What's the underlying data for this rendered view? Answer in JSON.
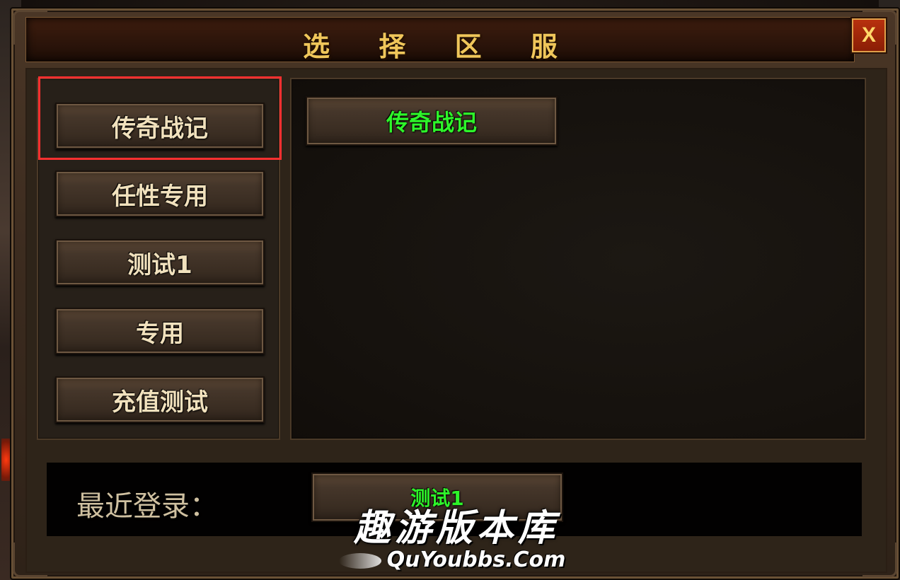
{
  "window": {
    "title": "选 择 区 服",
    "close_label": "X"
  },
  "server_groups": [
    {
      "label": "传奇战记",
      "selected": true
    },
    {
      "label": "任性专用",
      "selected": false
    },
    {
      "label": "测试1",
      "selected": false
    },
    {
      "label": "专用",
      "selected": false
    },
    {
      "label": "充值测试",
      "selected": false
    }
  ],
  "servers": [
    {
      "label": "传奇战记"
    }
  ],
  "recent": {
    "label": "最近登录：",
    "server_label": "测试1"
  },
  "watermark": {
    "chinese": "趣游版本库",
    "english": "QuYoubbs.Com"
  },
  "colors": {
    "title_gold": "#f0c65a",
    "server_green": "#2ef52a",
    "highlight_red": "#ff3030",
    "close_red": "#b8310e"
  }
}
